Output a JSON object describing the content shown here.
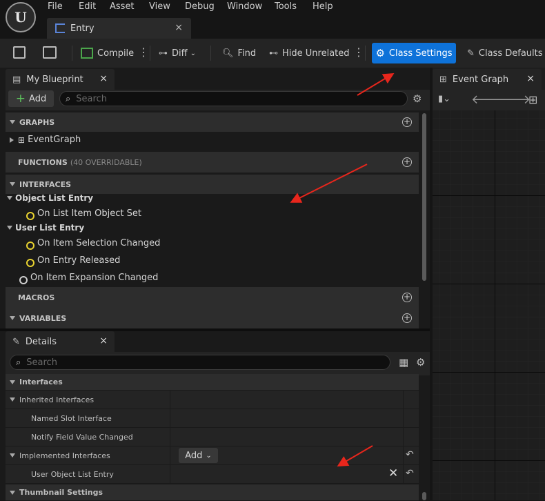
{
  "menubar": {
    "items": [
      "File",
      "Edit",
      "Asset",
      "View",
      "Debug",
      "Window",
      "Tools",
      "Help"
    ]
  },
  "asset_tab": {
    "label": "Entry",
    "close": "×"
  },
  "toolbar": {
    "compile": "Compile",
    "diff": "Diff",
    "find": "Find",
    "hide_unrelated": "Hide Unrelated",
    "class_settings": "Class Settings",
    "class_defaults": "Class Defaults"
  },
  "my_blueprint": {
    "title": "My Blueprint",
    "close": "×",
    "add": "Add",
    "search_placeholder": "Search",
    "graphs": "GRAPHS",
    "event_graph": "EventGraph",
    "functions": "FUNCTIONS",
    "functions_note": "(40 OVERRIDABLE)",
    "interfaces": "INTERFACES",
    "object_list_entry": "Object List Entry",
    "on_list_item_object_set": "On List Item Object Set",
    "user_list_entry": "User List Entry",
    "on_item_selection_changed": "On Item Selection Changed",
    "on_entry_released": "On Entry Released",
    "on_item_expansion_changed": "On Item Expansion Changed",
    "macros": "MACROS",
    "variables": "VARIABLES"
  },
  "details": {
    "title": "Details",
    "close": "×",
    "search_placeholder": "Search",
    "interfaces": "Interfaces",
    "inherited_interfaces": "Inherited Interfaces",
    "named_slot_interface": "Named Slot Interface",
    "notify_field_value_changed": "Notify Field Value Changed",
    "implemented_interfaces": "Implemented Interfaces",
    "add": "Add",
    "user_object_list_entry": "User Object List Entry",
    "thumbnail_settings": "Thumbnail Settings"
  },
  "event_graph": {
    "title": "Event Graph",
    "close": "×"
  },
  "colors": {
    "accent": "#0e72d9",
    "annotation_arrow": "#e8261c",
    "function_icon": "#e8d230"
  }
}
